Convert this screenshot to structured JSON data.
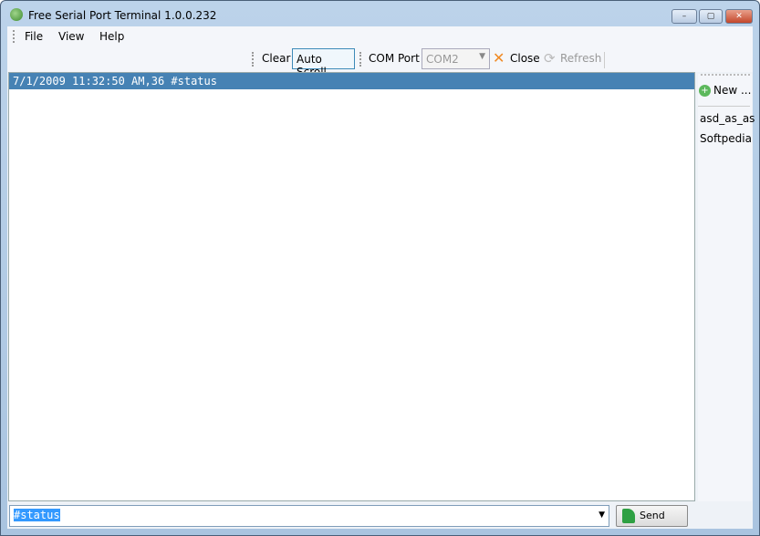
{
  "window": {
    "title": "Free Serial Port Terminal 1.0.0.232",
    "minimize": "–",
    "maximize": "▢",
    "close": "✕"
  },
  "menu": [
    "File",
    "View",
    "Help"
  ],
  "toolbar": {
    "clear": "Clear",
    "auto_scroll": "Auto Scroll",
    "com_port_label": "COM Port",
    "com_port_value": "COM2",
    "close": "Close",
    "refresh": "Refresh"
  },
  "log": {
    "lines": [
      "7/1/2009 11:32:50 AM,36 #status"
    ]
  },
  "sidebar": {
    "new": "New ...",
    "items": [
      "asd_as_as",
      "Softpedia"
    ]
  },
  "input": {
    "value": "#status",
    "send": "Send"
  },
  "colors": {
    "selection": "#4682b4",
    "accent_close": "#f08a24",
    "send_icon": "#2ea043"
  }
}
